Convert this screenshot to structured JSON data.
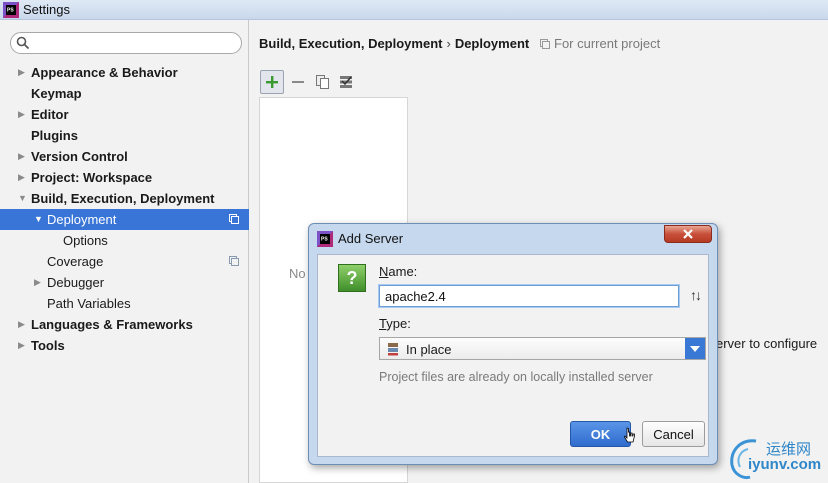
{
  "window": {
    "title": "Settings"
  },
  "search": {
    "placeholder": ""
  },
  "tree": [
    {
      "label": "Appearance & Behavior",
      "bold": true,
      "arrow": "right",
      "indent": 0
    },
    {
      "label": "Keymap",
      "bold": true,
      "arrow": "",
      "indent": 0
    },
    {
      "label": "Editor",
      "bold": true,
      "arrow": "right",
      "indent": 0
    },
    {
      "label": "Plugins",
      "bold": true,
      "arrow": "",
      "indent": 0
    },
    {
      "label": "Version Control",
      "bold": true,
      "arrow": "right",
      "indent": 0
    },
    {
      "label": "Project: Workspace",
      "bold": true,
      "arrow": "right",
      "indent": 0
    },
    {
      "label": "Build, Execution, Deployment",
      "bold": true,
      "arrow": "down",
      "indent": 0
    },
    {
      "label": "Deployment",
      "bold": false,
      "arrow": "down",
      "indent": 1,
      "selected": true,
      "project_icon": true
    },
    {
      "label": "Options",
      "bold": false,
      "arrow": "",
      "indent": 2
    },
    {
      "label": "Coverage",
      "bold": false,
      "arrow": "",
      "indent": 1,
      "project_icon": true
    },
    {
      "label": "Debugger",
      "bold": false,
      "arrow": "right",
      "indent": 1
    },
    {
      "label": "Path Variables",
      "bold": false,
      "arrow": "",
      "indent": 1
    },
    {
      "label": "Languages & Frameworks",
      "bold": true,
      "arrow": "right",
      "indent": 0
    },
    {
      "label": "Tools",
      "bold": true,
      "arrow": "right",
      "indent": 0
    }
  ],
  "main": {
    "breadcrumb": [
      "Build, Execution, Deployment",
      "Deployment"
    ],
    "breadcrumb_separator": "›",
    "scope_label": "For current project",
    "empty_list_text": "No",
    "configure_text": "erver to configure"
  },
  "dialog": {
    "title": "Add Server",
    "name_label_mnemonic": "N",
    "name_label_rest": "ame:",
    "name_value": "apache2.4",
    "sort_glyph": "↑↓",
    "type_label_mnemonic": "T",
    "type_label_rest": "ype:",
    "type_value": "In place",
    "hint": "Project files are already on locally installed server",
    "ok_label": "OK",
    "cancel_label": "Cancel",
    "help_glyph": "?"
  },
  "watermark": {
    "cn": "运维网",
    "url": "iyunv.com"
  },
  "colors": {
    "selection": "#3875d7",
    "ok_button": "#2f6ccd",
    "dialog_frame": "#c5d8ee"
  }
}
